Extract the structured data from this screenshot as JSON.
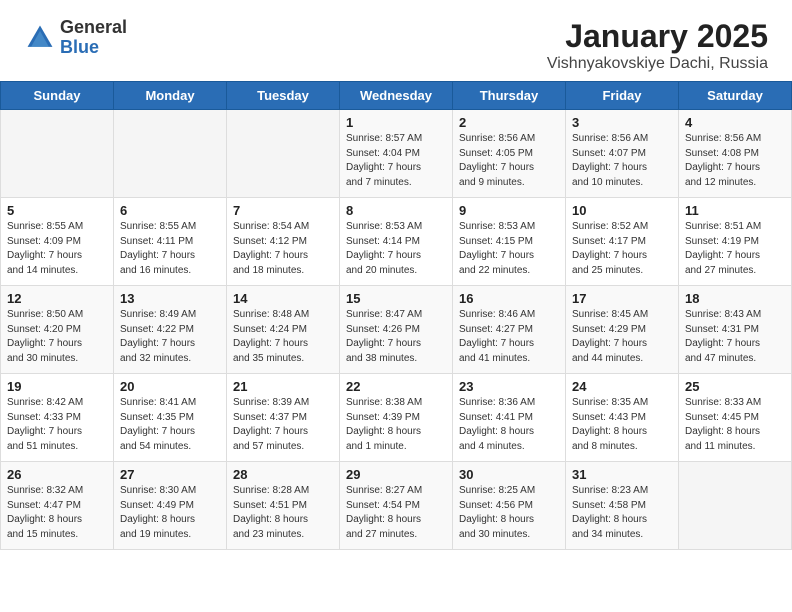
{
  "header": {
    "logo_general": "General",
    "logo_blue": "Blue",
    "title": "January 2025",
    "location": "Vishnyakovskiye Dachi, Russia"
  },
  "days_of_week": [
    "Sunday",
    "Monday",
    "Tuesday",
    "Wednesday",
    "Thursday",
    "Friday",
    "Saturday"
  ],
  "weeks": [
    [
      {
        "day": "",
        "info": ""
      },
      {
        "day": "",
        "info": ""
      },
      {
        "day": "",
        "info": ""
      },
      {
        "day": "1",
        "info": "Sunrise: 8:57 AM\nSunset: 4:04 PM\nDaylight: 7 hours\nand 7 minutes."
      },
      {
        "day": "2",
        "info": "Sunrise: 8:56 AM\nSunset: 4:05 PM\nDaylight: 7 hours\nand 9 minutes."
      },
      {
        "day": "3",
        "info": "Sunrise: 8:56 AM\nSunset: 4:07 PM\nDaylight: 7 hours\nand 10 minutes."
      },
      {
        "day": "4",
        "info": "Sunrise: 8:56 AM\nSunset: 4:08 PM\nDaylight: 7 hours\nand 12 minutes."
      }
    ],
    [
      {
        "day": "5",
        "info": "Sunrise: 8:55 AM\nSunset: 4:09 PM\nDaylight: 7 hours\nand 14 minutes."
      },
      {
        "day": "6",
        "info": "Sunrise: 8:55 AM\nSunset: 4:11 PM\nDaylight: 7 hours\nand 16 minutes."
      },
      {
        "day": "7",
        "info": "Sunrise: 8:54 AM\nSunset: 4:12 PM\nDaylight: 7 hours\nand 18 minutes."
      },
      {
        "day": "8",
        "info": "Sunrise: 8:53 AM\nSunset: 4:14 PM\nDaylight: 7 hours\nand 20 minutes."
      },
      {
        "day": "9",
        "info": "Sunrise: 8:53 AM\nSunset: 4:15 PM\nDaylight: 7 hours\nand 22 minutes."
      },
      {
        "day": "10",
        "info": "Sunrise: 8:52 AM\nSunset: 4:17 PM\nDaylight: 7 hours\nand 25 minutes."
      },
      {
        "day": "11",
        "info": "Sunrise: 8:51 AM\nSunset: 4:19 PM\nDaylight: 7 hours\nand 27 minutes."
      }
    ],
    [
      {
        "day": "12",
        "info": "Sunrise: 8:50 AM\nSunset: 4:20 PM\nDaylight: 7 hours\nand 30 minutes."
      },
      {
        "day": "13",
        "info": "Sunrise: 8:49 AM\nSunset: 4:22 PM\nDaylight: 7 hours\nand 32 minutes."
      },
      {
        "day": "14",
        "info": "Sunrise: 8:48 AM\nSunset: 4:24 PM\nDaylight: 7 hours\nand 35 minutes."
      },
      {
        "day": "15",
        "info": "Sunrise: 8:47 AM\nSunset: 4:26 PM\nDaylight: 7 hours\nand 38 minutes."
      },
      {
        "day": "16",
        "info": "Sunrise: 8:46 AM\nSunset: 4:27 PM\nDaylight: 7 hours\nand 41 minutes."
      },
      {
        "day": "17",
        "info": "Sunrise: 8:45 AM\nSunset: 4:29 PM\nDaylight: 7 hours\nand 44 minutes."
      },
      {
        "day": "18",
        "info": "Sunrise: 8:43 AM\nSunset: 4:31 PM\nDaylight: 7 hours\nand 47 minutes."
      }
    ],
    [
      {
        "day": "19",
        "info": "Sunrise: 8:42 AM\nSunset: 4:33 PM\nDaylight: 7 hours\nand 51 minutes."
      },
      {
        "day": "20",
        "info": "Sunrise: 8:41 AM\nSunset: 4:35 PM\nDaylight: 7 hours\nand 54 minutes."
      },
      {
        "day": "21",
        "info": "Sunrise: 8:39 AM\nSunset: 4:37 PM\nDaylight: 7 hours\nand 57 minutes."
      },
      {
        "day": "22",
        "info": "Sunrise: 8:38 AM\nSunset: 4:39 PM\nDaylight: 8 hours\nand 1 minute."
      },
      {
        "day": "23",
        "info": "Sunrise: 8:36 AM\nSunset: 4:41 PM\nDaylight: 8 hours\nand 4 minutes."
      },
      {
        "day": "24",
        "info": "Sunrise: 8:35 AM\nSunset: 4:43 PM\nDaylight: 8 hours\nand 8 minutes."
      },
      {
        "day": "25",
        "info": "Sunrise: 8:33 AM\nSunset: 4:45 PM\nDaylight: 8 hours\nand 11 minutes."
      }
    ],
    [
      {
        "day": "26",
        "info": "Sunrise: 8:32 AM\nSunset: 4:47 PM\nDaylight: 8 hours\nand 15 minutes."
      },
      {
        "day": "27",
        "info": "Sunrise: 8:30 AM\nSunset: 4:49 PM\nDaylight: 8 hours\nand 19 minutes."
      },
      {
        "day": "28",
        "info": "Sunrise: 8:28 AM\nSunset: 4:51 PM\nDaylight: 8 hours\nand 23 minutes."
      },
      {
        "day": "29",
        "info": "Sunrise: 8:27 AM\nSunset: 4:54 PM\nDaylight: 8 hours\nand 27 minutes."
      },
      {
        "day": "30",
        "info": "Sunrise: 8:25 AM\nSunset: 4:56 PM\nDaylight: 8 hours\nand 30 minutes."
      },
      {
        "day": "31",
        "info": "Sunrise: 8:23 AM\nSunset: 4:58 PM\nDaylight: 8 hours\nand 34 minutes."
      },
      {
        "day": "",
        "info": ""
      }
    ]
  ]
}
